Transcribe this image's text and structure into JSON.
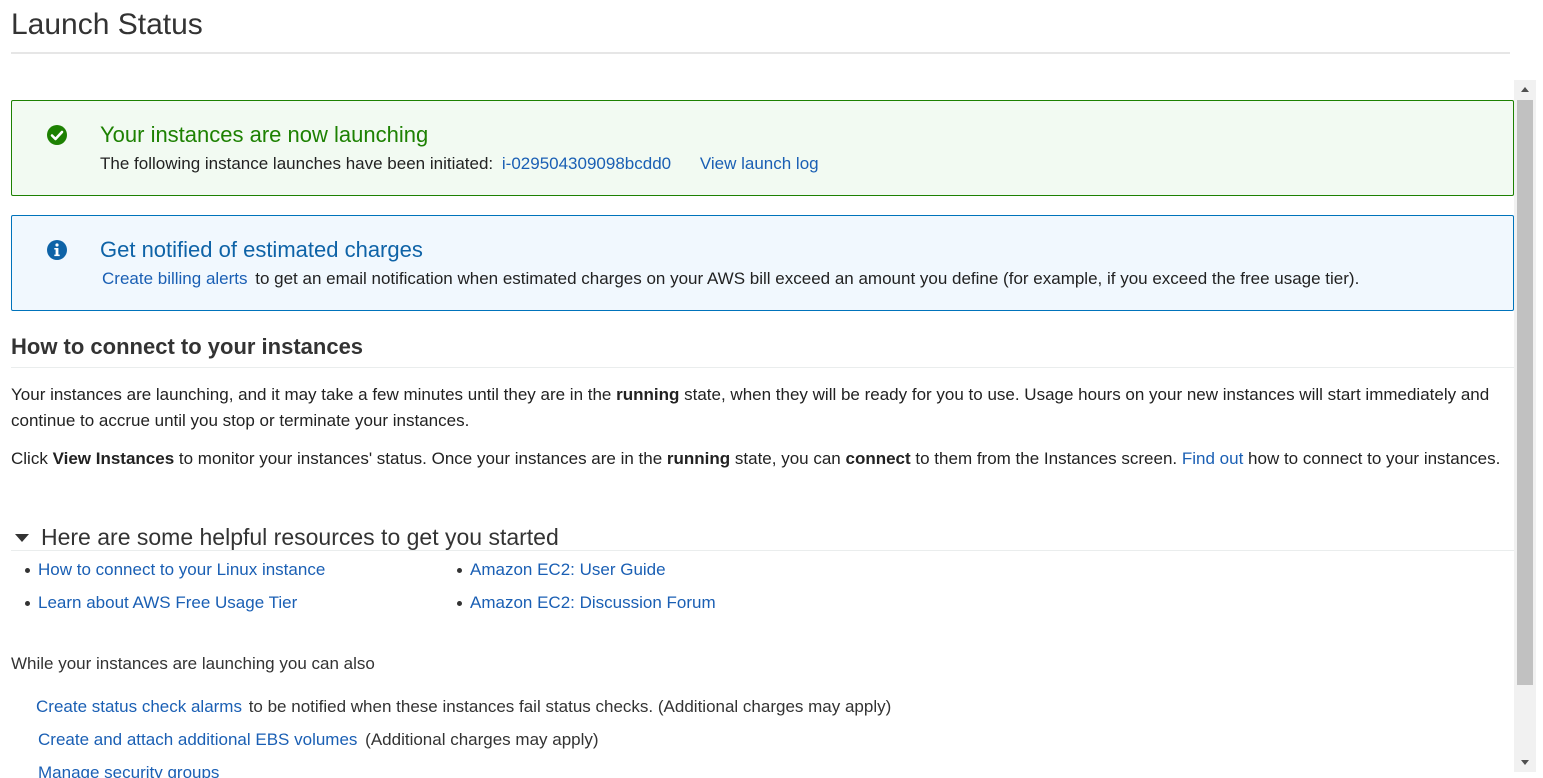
{
  "page": {
    "title": "Launch Status"
  },
  "success_alert": {
    "heading": "Your instances are now launching",
    "text": "The following instance launches have been initiated:",
    "instance_id": "i-029504309098bcdd0",
    "view_log": "View launch log",
    "color": "#1d8102"
  },
  "info_alert": {
    "heading": "Get notified of estimated charges",
    "link": "Create billing alerts",
    "text": "to get an email notification when estimated charges on your AWS bill exceed an amount you define (for example, if you exceed the free usage tier).",
    "color": "#0073bb"
  },
  "connect": {
    "heading": "How to connect to your instances",
    "p1": {
      "a": "Your instances are launching, and it may take a few minutes until they are in the",
      "b": "running",
      "c": "state, when they will be ready for you to use. Usage hours on your new instances will start immediately and continue to accrue until you stop or terminate your instances."
    },
    "p2": {
      "a": "Click",
      "b": "View Instances",
      "c": "to monitor your instances' status. Once your instances are in the",
      "d": "running",
      "e": "state, you can",
      "f": "connect",
      "g": "to them from the Instances screen.",
      "link": "Find out",
      "h": "how to connect to your instances."
    }
  },
  "resources": {
    "heading": "Here are some helpful resources to get you started",
    "left": [
      "How to connect to your Linux instance",
      "Learn about AWS Free Usage Tier"
    ],
    "right": [
      "Amazon EC2: User Guide",
      "Amazon EC2: Discussion Forum"
    ]
  },
  "also": {
    "heading": "While your instances are launching you can also",
    "actions": [
      {
        "link": "Create status check alarms",
        "text": "to be notified when these instances fail status checks. (Additional charges may apply)"
      },
      {
        "link": "Create and attach additional EBS volumes",
        "text": "(Additional charges may apply)"
      },
      {
        "link": "Manage security groups",
        "text": ""
      }
    ]
  }
}
